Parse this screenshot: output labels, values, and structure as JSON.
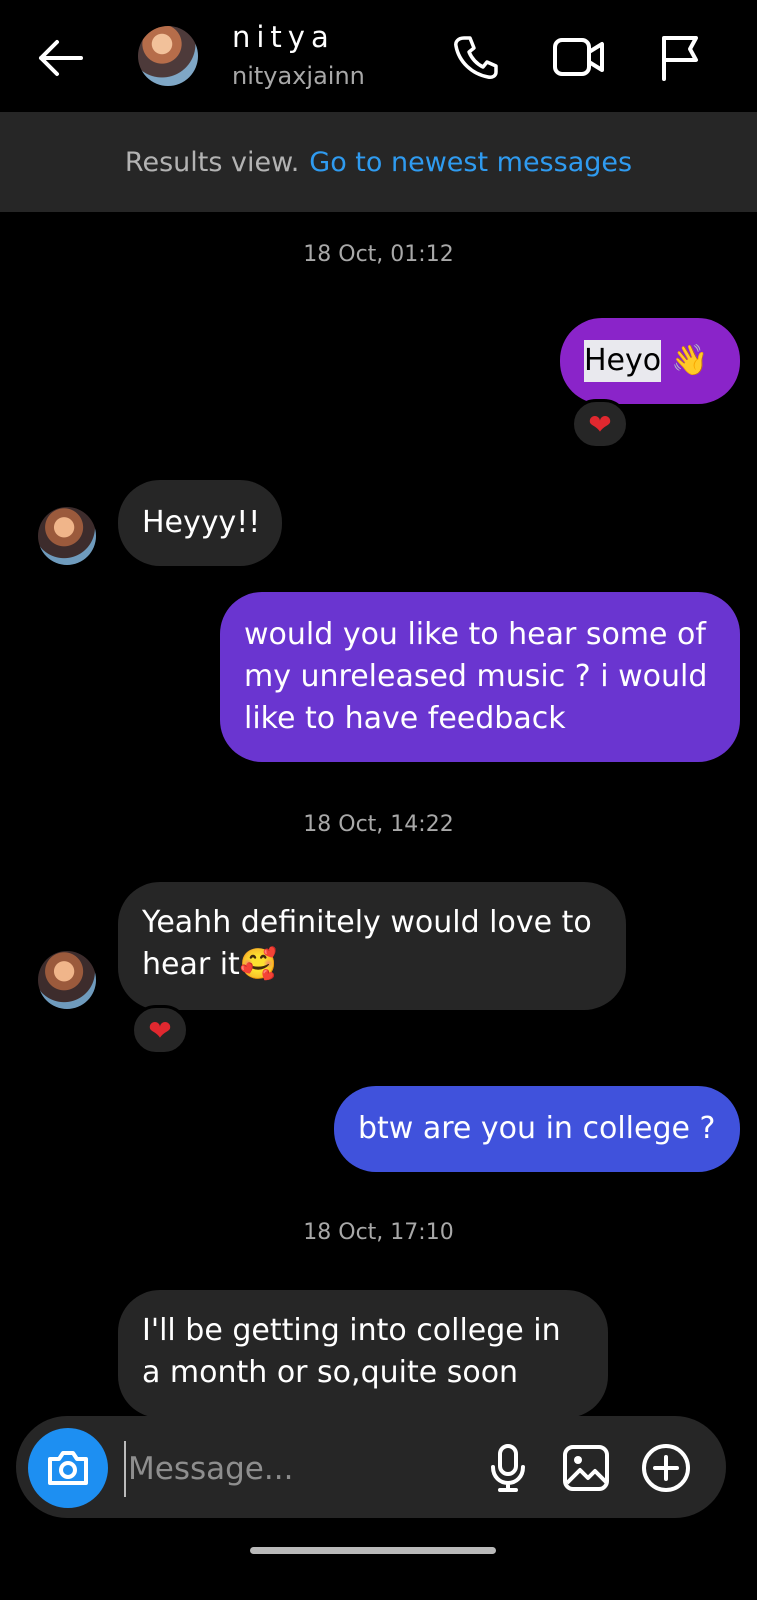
{
  "header": {
    "name": "nitya",
    "handle": "nityaxjainn"
  },
  "banner": {
    "results_text": "Results view.",
    "link_text": "Go to newest messages",
    "link_color": "#2f9bf0"
  },
  "messages": {
    "ts1": "18 Oct, 01:12",
    "m1_text": "Heyo",
    "m1_emoji": "👋",
    "m1_reaction": "❤",
    "m2_text": "Heyyy!!",
    "m3_text": "would you like to hear some of my unreleased music ? i would like to have feedback",
    "ts2": "18 Oct, 14:22",
    "m4_text": "Yeahh definitely would love to hear it",
    "m4_emoji": "🥰",
    "m4_reaction": "❤",
    "m5_text": "btw are you in college ?",
    "ts3": "18 Oct, 17:10",
    "m6_text": "I'll be getting into college in a month or so,quite soon"
  },
  "composer": {
    "placeholder": "Message..."
  },
  "colors": {
    "background": "#000000",
    "incoming_bubble": "#262626",
    "outgoing_top": "#8a24c9",
    "outgoing_mid": "#6a35d0",
    "outgoing_bottom": "#4052dc",
    "camera_button": "#1d8ff2"
  }
}
